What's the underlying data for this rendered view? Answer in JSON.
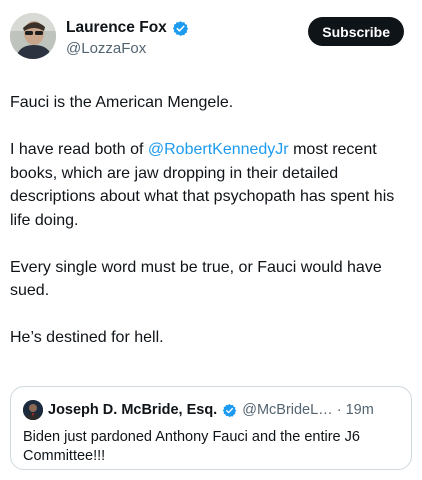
{
  "author": {
    "display_name": "Laurence Fox",
    "handle": "@LozzaFox",
    "avatar_icon": "profile-photo-avatar",
    "verified_icon": "verified-badge-icon"
  },
  "subscribe_label": "Subscribe",
  "tweet": {
    "line1": "Fauci is the American Mengele.",
    "p2_before": "I have read both of ",
    "p2_mention": "@RobertKennedyJr",
    "p2_after": " most recent books, which are jaw dropping in their detailed descriptions about what that psychopath has spent his life doing.",
    "p3": "Every single word must be true, or Fauci would have sued.",
    "p4": "He’s destined for hell."
  },
  "quote": {
    "display_name": "Joseph D. McBride, Esq.",
    "handle_time": "@McBrideL… · 19m",
    "text": "Biden just pardoned Anthony Fauci and the entire J6 Committee!!!"
  },
  "colors": {
    "text": "#0f1419",
    "secondary": "#536471",
    "link": "#1d9bf0",
    "border": "#cfd9de"
  }
}
